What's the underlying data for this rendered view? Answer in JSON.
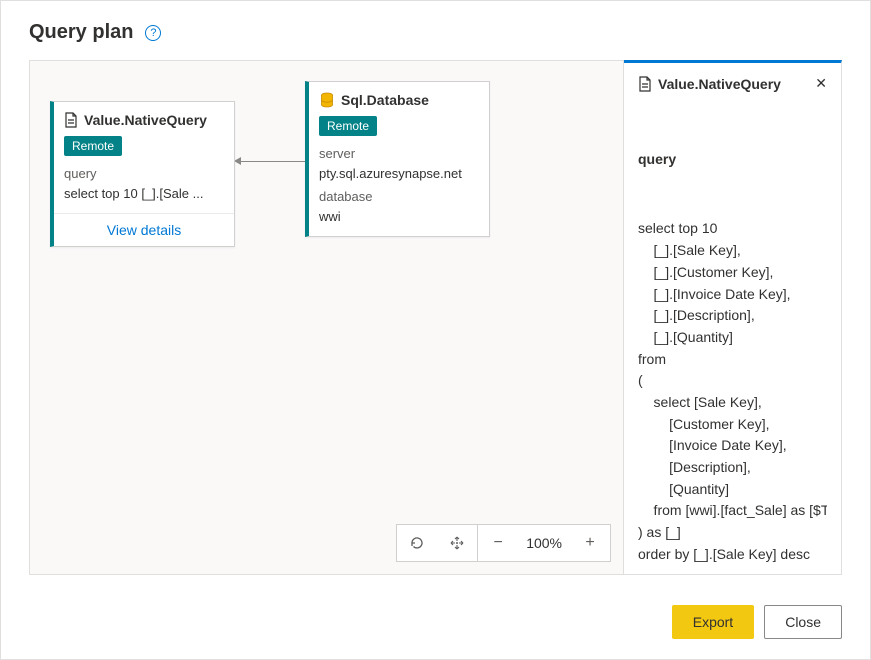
{
  "header": {
    "title": "Query plan"
  },
  "canvas": {
    "zoom": "100%",
    "node1": {
      "title": "Value.NativeQuery",
      "badge": "Remote",
      "param_label": "query",
      "param_value": "select top 10 [_].[Sale ...",
      "view_details": "View details"
    },
    "node2": {
      "title": "Sql.Database",
      "badge": "Remote",
      "param1_label": "server",
      "param1_value": "pty.sql.azuresynapse.net",
      "param2_label": "database",
      "param2_value": "wwi"
    }
  },
  "details": {
    "title": "Value.NativeQuery",
    "section_label": "query",
    "query_text": "select top 10\n    [_].[Sale Key],\n    [_].[Customer Key],\n    [_].[Invoice Date Key],\n    [_].[Description],\n    [_].[Quantity]\nfrom\n(\n    select [Sale Key],\n        [Customer Key],\n        [Invoice Date Key],\n        [Description],\n        [Quantity]\n    from [wwi].[fact_Sale] as [$Table]\n) as [_]\norder by [_].[Sale Key] desc"
  },
  "footer": {
    "export": "Export",
    "close": "Close"
  }
}
